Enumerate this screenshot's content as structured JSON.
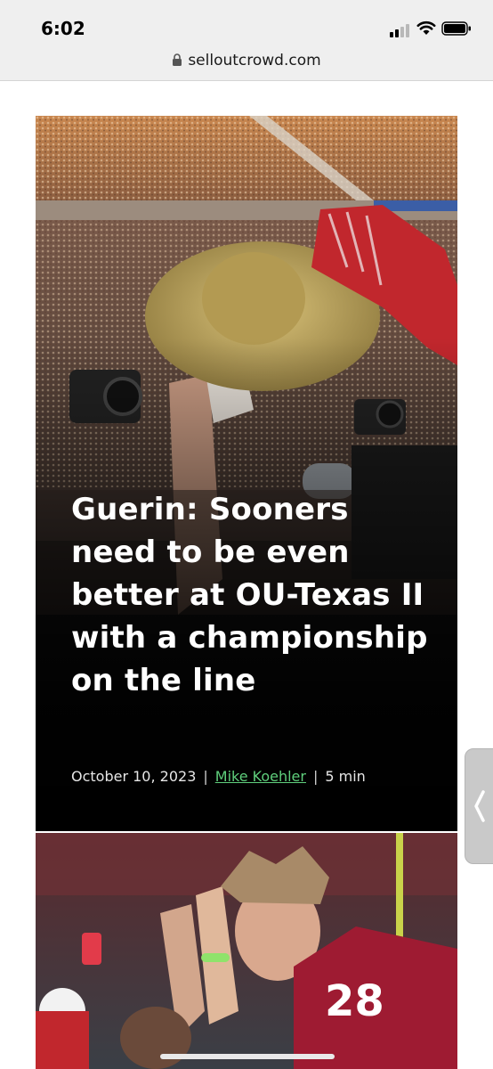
{
  "status_bar": {
    "time": "6:02"
  },
  "browser": {
    "url": "selloutcrowd.com"
  },
  "article": {
    "headline": "Guerin: Sooners need to be even better at OU-Texas II with a championship on the line",
    "date": "October 10, 2023",
    "separator": "|",
    "author": "Mike Koehler",
    "read_time": "5 min"
  },
  "second_card": {
    "jersey_number": "28"
  },
  "icons": [
    "lock-icon",
    "signal-icon",
    "wifi-icon",
    "battery-icon",
    "chevron-left-icon"
  ]
}
